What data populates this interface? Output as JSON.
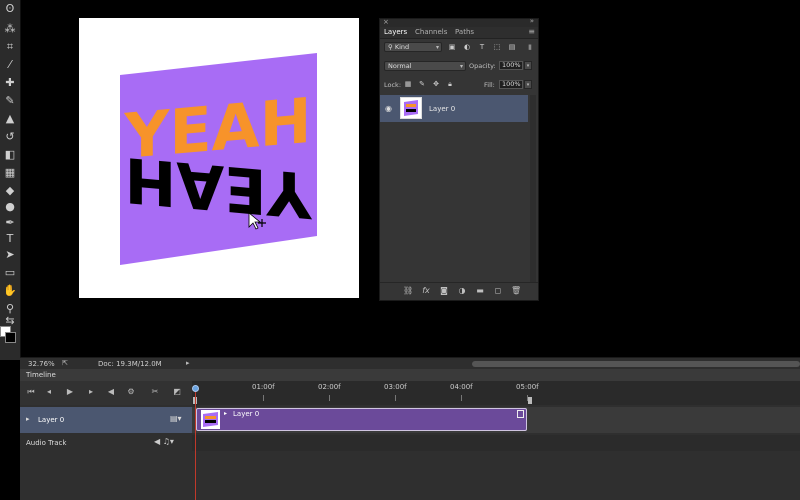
{
  "tools": [
    {
      "name": "lasso-tool-icon",
      "glyph": "ʘ"
    },
    {
      "name": "quick-select-tool-icon",
      "glyph": "⁂"
    },
    {
      "name": "crop-tool-icon",
      "glyph": "⌗"
    },
    {
      "name": "eyedropper-tool-icon",
      "glyph": "⁄"
    },
    {
      "name": "healing-brush-tool-icon",
      "glyph": "✚"
    },
    {
      "name": "brush-tool-icon",
      "glyph": "✎"
    },
    {
      "name": "stamp-tool-icon",
      "glyph": "▲"
    },
    {
      "name": "history-brush-tool-icon",
      "glyph": "↺"
    },
    {
      "name": "eraser-tool-icon",
      "glyph": "◧"
    },
    {
      "name": "gradient-tool-icon",
      "glyph": "▦"
    },
    {
      "name": "blur-tool-icon",
      "glyph": "◆"
    },
    {
      "name": "dodge-tool-icon",
      "glyph": "●"
    },
    {
      "name": "pen-tool-icon",
      "glyph": "✒"
    },
    {
      "name": "type-tool-icon",
      "glyph": "T"
    },
    {
      "name": "path-select-tool-icon",
      "glyph": "➤"
    },
    {
      "name": "shape-tool-icon",
      "glyph": "▭"
    },
    {
      "name": "hand-tool-icon",
      "glyph": "✋"
    },
    {
      "name": "zoom-tool-icon",
      "glyph": "⚲"
    },
    {
      "name": "swap-colors-icon",
      "glyph": "⇆"
    }
  ],
  "layers_panel": {
    "tabs": [
      "Layers",
      "Channels",
      "Paths"
    ],
    "active_tab": "Layers",
    "filter_kind": "Kind",
    "blend_mode": "Normal",
    "opacity_label": "Opacity:",
    "opacity_value": "100%",
    "lock_label": "Lock:",
    "fill_label": "Fill:",
    "fill_value": "100%",
    "layers": [
      {
        "name": "Layer 0",
        "visible": true,
        "selected": true
      }
    ]
  },
  "status": {
    "zoom": "32.76%",
    "doc": "Doc: 19.3M/12.0M"
  },
  "timeline": {
    "title": "Timeline",
    "ticks": [
      "01:00f",
      "02:00f",
      "03:00f",
      "04:00f",
      "05:00f"
    ],
    "video_track": "Layer 0",
    "clip_name": "Layer 0",
    "audio_track": "Audio Track"
  },
  "artwork": {
    "top_word": "YEAH",
    "bottom_word": "YEAH",
    "bg_color": "#a86cf5",
    "top_color": "#f7932a",
    "bottom_color": "#000000"
  }
}
